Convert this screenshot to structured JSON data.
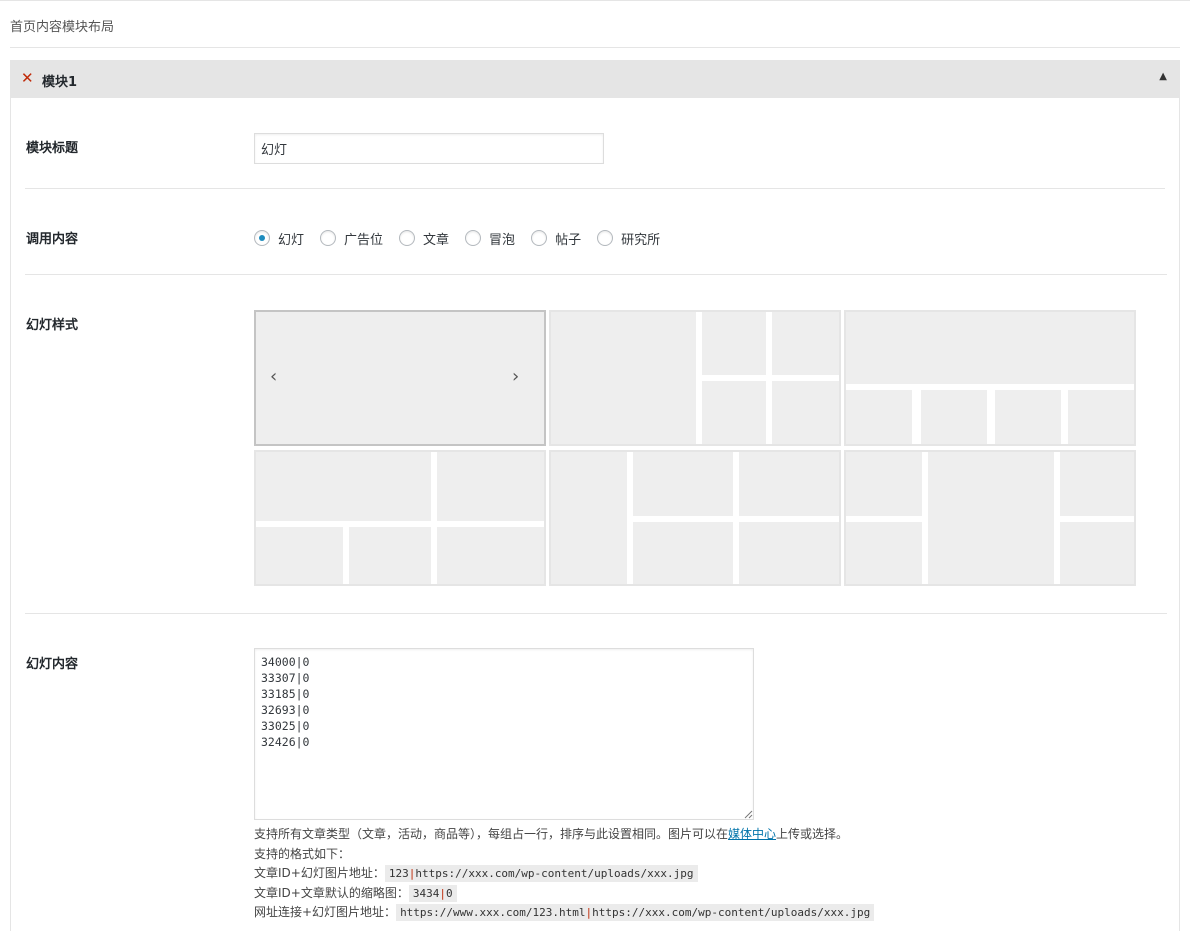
{
  "page": {
    "title": "首页内容模块布局"
  },
  "module": {
    "header_title": "模块1",
    "close_glyph": "✕",
    "toggle_glyph": "▲",
    "fields": {
      "title_label": "模块标题",
      "title_value": "幻灯",
      "content_label": "调用内容",
      "content_options": [
        "幻灯",
        "广告位",
        "文章",
        "冒泡",
        "帖子",
        "研究所"
      ],
      "content_selected": 0,
      "style_label": "幻灯样式",
      "style_selected": 0,
      "slides_label": "幻灯内容",
      "slides_value": "34000|0\n33307|0\n33185|0\n32693|0\n33025|0\n32426|0"
    },
    "help": {
      "line1_pre": "支持所有文章类型（文章，活动，商品等），每组占一行，排序与此设置相同。图片可以在",
      "line1_link": "媒体中心",
      "line1_post": "上传或选择。",
      "line2": "支持的格式如下：",
      "line3_label": "文章ID+幻灯图片地址：",
      "line3_code_a": "123",
      "line3_code_b": "https://xxx.com/wp-content/uploads/xxx.jpg",
      "line4_label": "文章ID+文章默认的缩略图：",
      "line4_code_a": "3434",
      "line4_code_b": "0",
      "line5_label": "网址连接+幻灯图片地址：",
      "line5_code_a": "https://www.xxx.com/123.html",
      "line5_code_b": "https://xxx.com/wp-content/uploads/xxx.jpg",
      "pipe": "|"
    }
  },
  "colors": {
    "accent": "#1e8cbe",
    "danger": "#c02b0a",
    "link": "#0073aa",
    "tile_fill": "#eeeeee"
  },
  "icons": {
    "close": "close-icon",
    "toggle": "triangle-up-icon",
    "prev": "chevron-left-icon",
    "next": "chevron-right-icon"
  }
}
